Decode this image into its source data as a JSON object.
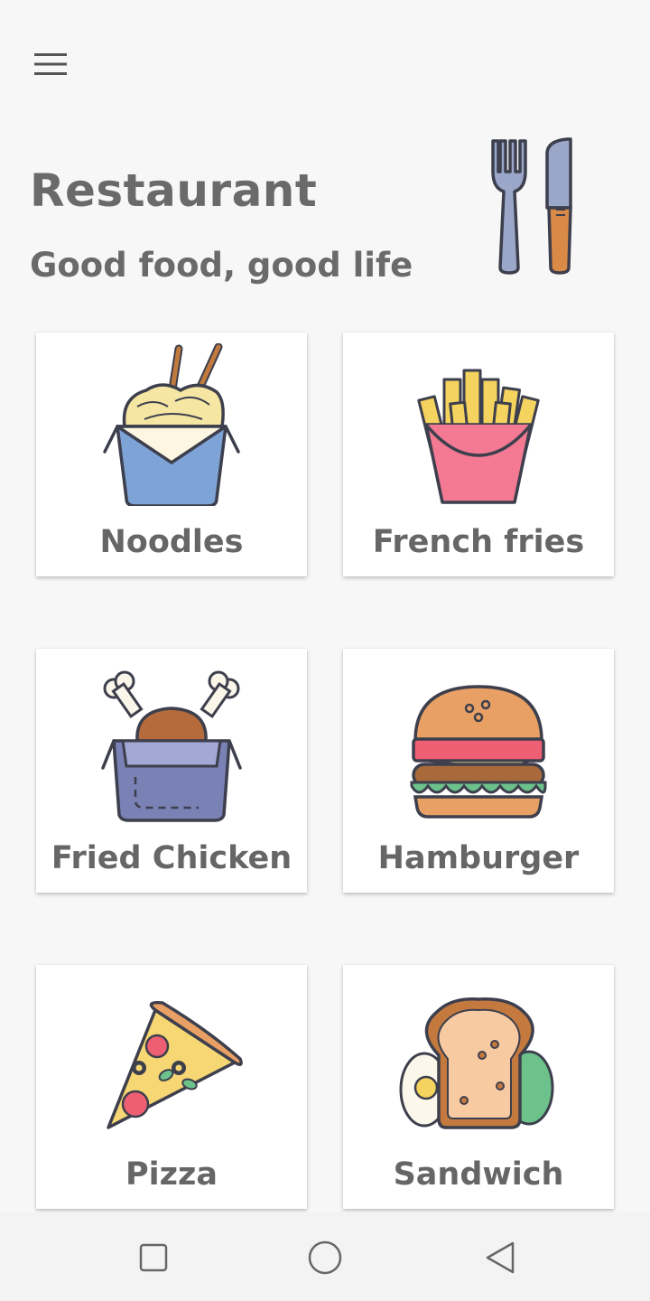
{
  "header": {
    "title": "Restaurant",
    "subtitle": "Good food, good life"
  },
  "menu_items": [
    {
      "label": "Noodles",
      "icon": "noodles-icon"
    },
    {
      "label": "French fries",
      "icon": "french-fries-icon"
    },
    {
      "label": "Fried Chicken",
      "icon": "fried-chicken-icon"
    },
    {
      "label": "Hamburger",
      "icon": "hamburger-icon"
    },
    {
      "label": "Pizza",
      "icon": "pizza-icon"
    },
    {
      "label": "Sandwich",
      "icon": "sandwich-icon"
    }
  ],
  "icons": {
    "menu": "hamburger-menu-icon",
    "header": "fork-knife-icon",
    "nav": [
      "recents-square-icon",
      "home-circle-icon",
      "back-triangle-icon"
    ]
  },
  "colors": {
    "background": "#f7f7f7",
    "card": "#ffffff",
    "text": "#6a6a6a",
    "navbar": "#f3f3f3"
  }
}
